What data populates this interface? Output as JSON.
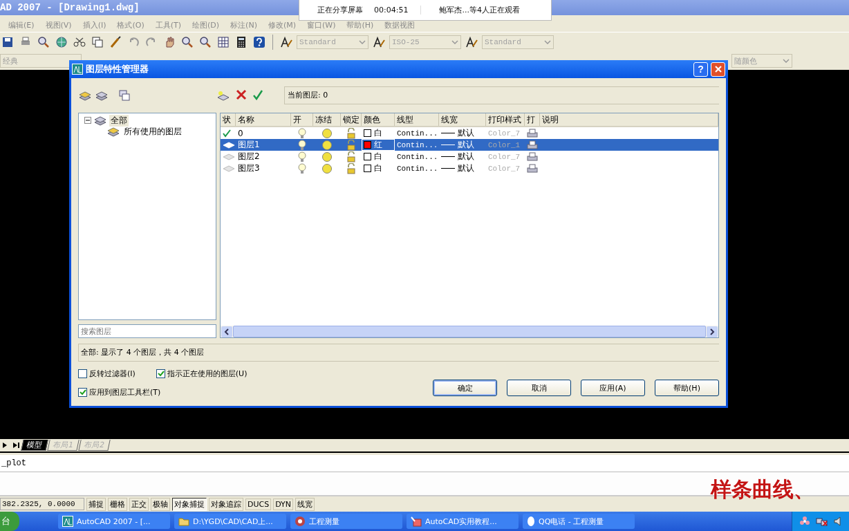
{
  "window": {
    "title": "AD 2007 - [Drawing1.dwg]"
  },
  "share_banner": {
    "status": "正在分享屏幕",
    "time": "00:04:51",
    "viewers": "鲍军杰...等4人正在观看"
  },
  "menu": [
    "编辑(E)",
    "视图(V)",
    "插入(I)",
    "格式(O)",
    "工具(T)",
    "绘图(D)",
    "标注(N)",
    "修改(M)",
    "窗口(W)",
    "帮助(H)",
    "数据视图"
  ],
  "toolbar": {
    "styles": [
      "Standard",
      "ISO-25",
      "Standard"
    ]
  },
  "toolbar2": {
    "workspace": "经典",
    "plot_dropdown": "随颜色"
  },
  "dialog": {
    "title": "图层特性管理器",
    "help_button": "?",
    "current_layer": "当前图层: 0",
    "tree": [
      {
        "label": "全部",
        "expanded": true,
        "selected": true,
        "children": [
          {
            "label": "所有使用的图层",
            "selected": false
          }
        ]
      }
    ],
    "search": {
      "placeholder": "搜索图层"
    },
    "columns": [
      "状",
      "名称",
      "开",
      "冻结",
      "锁定",
      "颜色",
      "线型",
      "线宽",
      "打印样式",
      "打",
      "说明"
    ],
    "rows": [
      {
        "current": true,
        "name": "0",
        "on": true,
        "frozen": false,
        "locked": false,
        "color": "#ffffff",
        "color_name": "白",
        "linetype": "Contin...",
        "lineweight": "默认",
        "plot_style": "Color_7",
        "selected": false
      },
      {
        "current": false,
        "name": "图层1",
        "on": true,
        "frozen": false,
        "locked": false,
        "color": "#ff0000",
        "color_name": "红",
        "linetype": "Contin...",
        "lineweight": "默认",
        "plot_style": "Color_1",
        "selected": true
      },
      {
        "current": false,
        "name": "图层2",
        "on": true,
        "frozen": false,
        "locked": false,
        "color": "#ffffff",
        "color_name": "白",
        "linetype": "Contin...",
        "lineweight": "默认",
        "plot_style": "Color_7",
        "selected": false
      },
      {
        "current": false,
        "name": "图层3",
        "on": true,
        "frozen": false,
        "locked": false,
        "color": "#ffffff",
        "color_name": "白",
        "linetype": "Contin...",
        "lineweight": "默认",
        "plot_style": "Color_7",
        "selected": false
      }
    ],
    "summary": "全部: 显示了 4 个图层，共 4 个图层",
    "options": [
      {
        "label": "反转过滤器(I)",
        "checked": false
      },
      {
        "label": "指示正在使用的图层(U)",
        "checked": true
      },
      {
        "label": "应用到图层工具栏(T)",
        "checked": true
      }
    ],
    "buttons": [
      {
        "label": "确定",
        "default": true
      },
      {
        "label": "取消",
        "default": false
      },
      {
        "label": "应用(A)",
        "default": false
      },
      {
        "label": "帮助(H)",
        "default": false
      }
    ]
  },
  "layout_tabs": [
    {
      "label": "模型",
      "selected": true
    },
    {
      "label": "布局1",
      "selected": false
    },
    {
      "label": "布局2",
      "selected": false
    }
  ],
  "command": {
    "line": "_plot"
  },
  "subtitle": "样条曲线、",
  "status_bar": {
    "coords": "382.2325, 0.0000",
    "toggles": [
      {
        "label": "捕捉",
        "on": false
      },
      {
        "label": "栅格",
        "on": false
      },
      {
        "label": "正交",
        "on": false
      },
      {
        "label": "极轴",
        "on": false
      },
      {
        "label": "对象捕捉",
        "on": true
      },
      {
        "label": "对象追踪",
        "on": false
      },
      {
        "label": "DUCS",
        "on": false
      },
      {
        "label": "DYN",
        "on": false
      },
      {
        "label": "线宽",
        "on": false
      }
    ]
  },
  "taskbar": {
    "start": "台",
    "tasks": [
      {
        "kind": "cad",
        "label": "AutoCAD 2007 - [..."
      },
      {
        "kind": "folder",
        "label": "D:\\YGD\\CAD\\CAD上..."
      },
      {
        "kind": "app",
        "label": "工程测量"
      },
      {
        "kind": "doc",
        "label": "AutoCAD实用教程..."
      },
      {
        "kind": "qq",
        "label": "QQ电话 - 工程测量"
      }
    ]
  }
}
